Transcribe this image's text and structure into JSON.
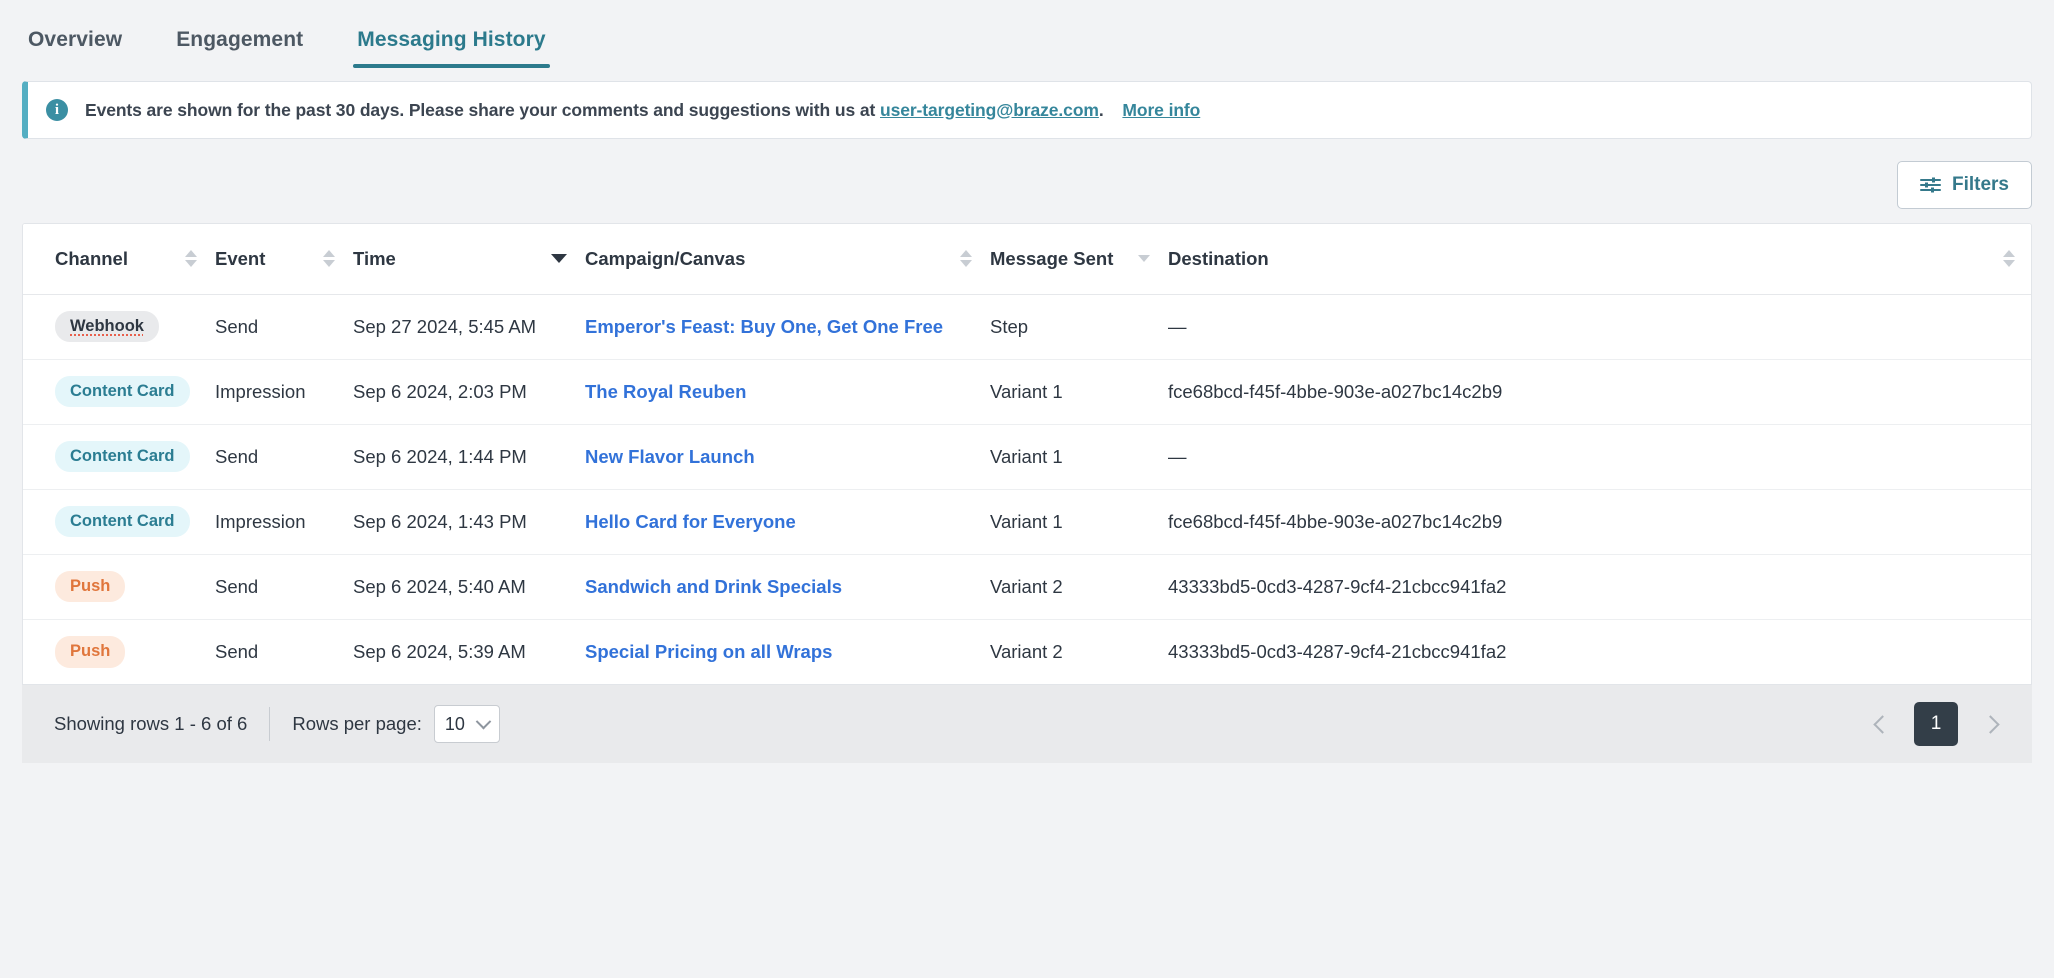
{
  "tabs": [
    {
      "label": "Overview",
      "active": false
    },
    {
      "label": "Engagement",
      "active": false
    },
    {
      "label": "Messaging History",
      "active": true
    }
  ],
  "banner": {
    "icon": "info-icon",
    "text_before": "Events are shown for the past 30 days. Please share your comments and suggestions with us at",
    "email_link": "user-targeting@braze.com",
    "period": ".",
    "more_info_link": "More info"
  },
  "toolbar": {
    "filters_label": "Filters",
    "filters_icon": "sliders-icon"
  },
  "table": {
    "columns": [
      {
        "label": "Channel",
        "sort": "both"
      },
      {
        "label": "Event",
        "sort": "both"
      },
      {
        "label": "Time",
        "sort": "desc-active"
      },
      {
        "label": "Campaign/Canvas",
        "sort": "both"
      },
      {
        "label": "Message Sent",
        "sort": "desc-only"
      },
      {
        "label": "Destination",
        "sort": "both"
      }
    ],
    "rows": [
      {
        "channel": "Webhook",
        "channel_style": "webhook",
        "event": "Send",
        "time": "Sep 27 2024, 5:45 AM",
        "campaign": "Emperor's Feast: Buy One, Get One Free",
        "message_sent": "Step",
        "destination": "—"
      },
      {
        "channel": "Content Card",
        "channel_style": "content-card",
        "event": "Impression",
        "time": "Sep 6 2024, 2:03 PM",
        "campaign": "The Royal Reuben",
        "message_sent": "Variant 1",
        "destination": "fce68bcd-f45f-4bbe-903e-a027bc14c2b9"
      },
      {
        "channel": "Content Card",
        "channel_style": "content-card",
        "event": "Send",
        "time": "Sep 6 2024, 1:44 PM",
        "campaign": "New Flavor Launch",
        "message_sent": "Variant 1",
        "destination": "—"
      },
      {
        "channel": "Content Card",
        "channel_style": "content-card",
        "event": "Impression",
        "time": "Sep 6 2024, 1:43 PM",
        "campaign": "Hello Card for Everyone",
        "message_sent": "Variant 1",
        "destination": "fce68bcd-f45f-4bbe-903e-a027bc14c2b9"
      },
      {
        "channel": "Push",
        "channel_style": "push",
        "event": "Send",
        "time": "Sep 6 2024, 5:40 AM",
        "campaign": "Sandwich and Drink Specials",
        "message_sent": "Variant 2",
        "destination": "43333bd5-0cd3-4287-9cf4-21cbcc941fa2"
      },
      {
        "channel": "Push",
        "channel_style": "push",
        "event": "Send",
        "time": "Sep 6 2024, 5:39 AM",
        "campaign": "Special Pricing on all Wraps",
        "message_sent": "Variant 2",
        "destination": "43333bd5-0cd3-4287-9cf4-21cbcc941fa2"
      }
    ]
  },
  "footer": {
    "showing": "Showing rows 1 - 6 of 6",
    "rows_per_page_label": "Rows per page:",
    "rows_per_page_value": "10",
    "page_current": "1",
    "prev_icon": "chevron-left-icon",
    "next_icon": "chevron-right-icon"
  },
  "colors": {
    "accent_teal": "#2c7a8c",
    "link_blue": "#3272d9",
    "push_orange": "#e0763c",
    "banner_border": "#54aec2",
    "page_bg": "#f2f3f5"
  }
}
